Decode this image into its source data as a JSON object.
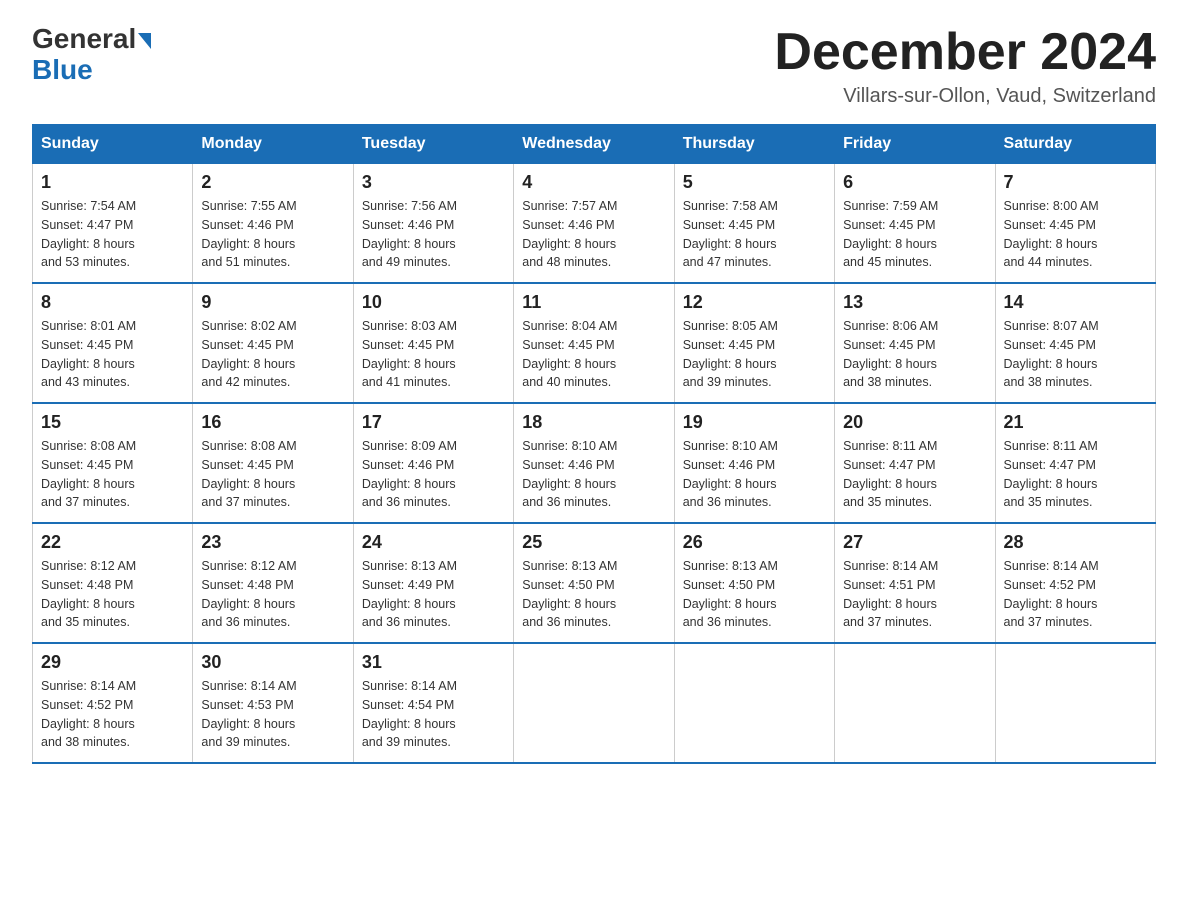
{
  "logo": {
    "general": "General",
    "blue": "Blue"
  },
  "header": {
    "month_year": "December 2024",
    "location": "Villars-sur-Ollon, Vaud, Switzerland"
  },
  "days_of_week": [
    "Sunday",
    "Monday",
    "Tuesday",
    "Wednesday",
    "Thursday",
    "Friday",
    "Saturday"
  ],
  "weeks": [
    [
      {
        "day": "1",
        "sunrise": "7:54 AM",
        "sunset": "4:47 PM",
        "daylight": "8 hours and 53 minutes."
      },
      {
        "day": "2",
        "sunrise": "7:55 AM",
        "sunset": "4:46 PM",
        "daylight": "8 hours and 51 minutes."
      },
      {
        "day": "3",
        "sunrise": "7:56 AM",
        "sunset": "4:46 PM",
        "daylight": "8 hours and 49 minutes."
      },
      {
        "day": "4",
        "sunrise": "7:57 AM",
        "sunset": "4:46 PM",
        "daylight": "8 hours and 48 minutes."
      },
      {
        "day": "5",
        "sunrise": "7:58 AM",
        "sunset": "4:45 PM",
        "daylight": "8 hours and 47 minutes."
      },
      {
        "day": "6",
        "sunrise": "7:59 AM",
        "sunset": "4:45 PM",
        "daylight": "8 hours and 45 minutes."
      },
      {
        "day": "7",
        "sunrise": "8:00 AM",
        "sunset": "4:45 PM",
        "daylight": "8 hours and 44 minutes."
      }
    ],
    [
      {
        "day": "8",
        "sunrise": "8:01 AM",
        "sunset": "4:45 PM",
        "daylight": "8 hours and 43 minutes."
      },
      {
        "day": "9",
        "sunrise": "8:02 AM",
        "sunset": "4:45 PM",
        "daylight": "8 hours and 42 minutes."
      },
      {
        "day": "10",
        "sunrise": "8:03 AM",
        "sunset": "4:45 PM",
        "daylight": "8 hours and 41 minutes."
      },
      {
        "day": "11",
        "sunrise": "8:04 AM",
        "sunset": "4:45 PM",
        "daylight": "8 hours and 40 minutes."
      },
      {
        "day": "12",
        "sunrise": "8:05 AM",
        "sunset": "4:45 PM",
        "daylight": "8 hours and 39 minutes."
      },
      {
        "day": "13",
        "sunrise": "8:06 AM",
        "sunset": "4:45 PM",
        "daylight": "8 hours and 38 minutes."
      },
      {
        "day": "14",
        "sunrise": "8:07 AM",
        "sunset": "4:45 PM",
        "daylight": "8 hours and 38 minutes."
      }
    ],
    [
      {
        "day": "15",
        "sunrise": "8:08 AM",
        "sunset": "4:45 PM",
        "daylight": "8 hours and 37 minutes."
      },
      {
        "day": "16",
        "sunrise": "8:08 AM",
        "sunset": "4:45 PM",
        "daylight": "8 hours and 37 minutes."
      },
      {
        "day": "17",
        "sunrise": "8:09 AM",
        "sunset": "4:46 PM",
        "daylight": "8 hours and 36 minutes."
      },
      {
        "day": "18",
        "sunrise": "8:10 AM",
        "sunset": "4:46 PM",
        "daylight": "8 hours and 36 minutes."
      },
      {
        "day": "19",
        "sunrise": "8:10 AM",
        "sunset": "4:46 PM",
        "daylight": "8 hours and 36 minutes."
      },
      {
        "day": "20",
        "sunrise": "8:11 AM",
        "sunset": "4:47 PM",
        "daylight": "8 hours and 35 minutes."
      },
      {
        "day": "21",
        "sunrise": "8:11 AM",
        "sunset": "4:47 PM",
        "daylight": "8 hours and 35 minutes."
      }
    ],
    [
      {
        "day": "22",
        "sunrise": "8:12 AM",
        "sunset": "4:48 PM",
        "daylight": "8 hours and 35 minutes."
      },
      {
        "day": "23",
        "sunrise": "8:12 AM",
        "sunset": "4:48 PM",
        "daylight": "8 hours and 36 minutes."
      },
      {
        "day": "24",
        "sunrise": "8:13 AM",
        "sunset": "4:49 PM",
        "daylight": "8 hours and 36 minutes."
      },
      {
        "day": "25",
        "sunrise": "8:13 AM",
        "sunset": "4:50 PM",
        "daylight": "8 hours and 36 minutes."
      },
      {
        "day": "26",
        "sunrise": "8:13 AM",
        "sunset": "4:50 PM",
        "daylight": "8 hours and 36 minutes."
      },
      {
        "day": "27",
        "sunrise": "8:14 AM",
        "sunset": "4:51 PM",
        "daylight": "8 hours and 37 minutes."
      },
      {
        "day": "28",
        "sunrise": "8:14 AM",
        "sunset": "4:52 PM",
        "daylight": "8 hours and 37 minutes."
      }
    ],
    [
      {
        "day": "29",
        "sunrise": "8:14 AM",
        "sunset": "4:52 PM",
        "daylight": "8 hours and 38 minutes."
      },
      {
        "day": "30",
        "sunrise": "8:14 AM",
        "sunset": "4:53 PM",
        "daylight": "8 hours and 39 minutes."
      },
      {
        "day": "31",
        "sunrise": "8:14 AM",
        "sunset": "4:54 PM",
        "daylight": "8 hours and 39 minutes."
      },
      null,
      null,
      null,
      null
    ]
  ],
  "labels": {
    "sunrise": "Sunrise:",
    "sunset": "Sunset:",
    "daylight": "Daylight:"
  }
}
